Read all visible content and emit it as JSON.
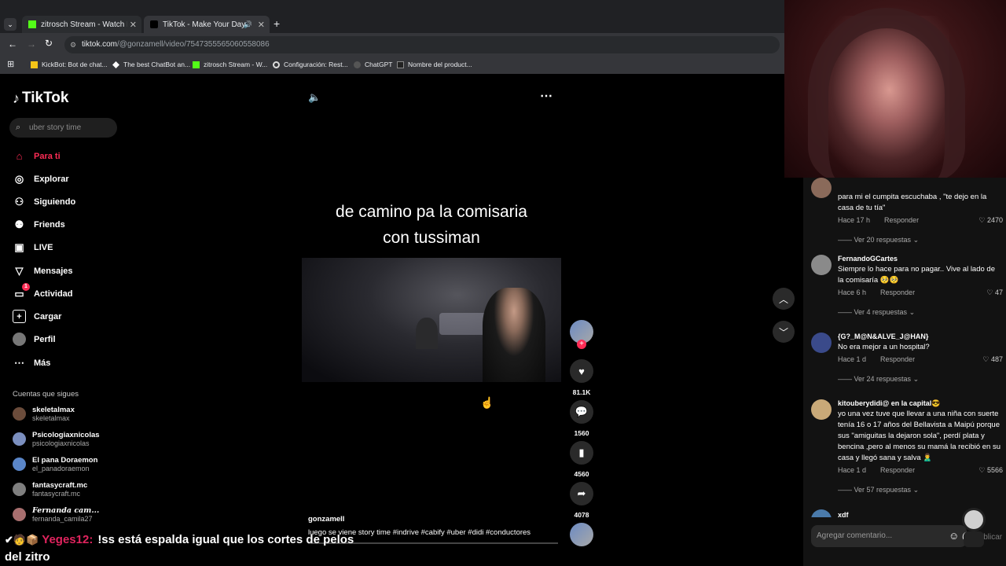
{
  "browser": {
    "tabs": [
      {
        "label": "zitrosch Stream - Watch Live on",
        "close": "✕"
      },
      {
        "label": "TikTok - Make Your Day",
        "close": "✕"
      }
    ],
    "new_tab": "+",
    "url_host": "tiktok.com",
    "url_path": "/@gonzamell/video/7547355565060558086",
    "bookmarks": [
      "KickBot: Bot de chat...",
      "The best ChatBot an...",
      "zitrosch Stream - W...",
      "Configuración: Rest...",
      "ChatGPT",
      "Nombre del product..."
    ]
  },
  "tiktok": {
    "logo": "TikTok",
    "search_placeholder": "uber story time",
    "nav": [
      "Para ti",
      "Explorar",
      "Siguiendo",
      "Friends",
      "LIVE",
      "Mensajes",
      "Actividad",
      "Cargar",
      "Perfil",
      "Más"
    ],
    "activity_badge": "1",
    "following_heading": "Cuentas que sigues",
    "following": [
      {
        "name": "skeletalmax",
        "handle": "skeletalmax",
        "color": "#6b4c3b"
      },
      {
        "name": "Psicologiaxnicolas",
        "handle": "psicologiaxnicolas",
        "color": "#7b8fbf"
      },
      {
        "name": "El pana Doraemon",
        "handle": "el_panadoraemon",
        "color": "#5a86c9"
      },
      {
        "name": "fantasycraft.mc",
        "handle": "fantasycraft.mc",
        "color": "#7f7f7f"
      },
      {
        "name": "Fernanda cam...",
        "handle": "fernanda_camila27",
        "color": "#a86f6f"
      }
    ],
    "caption_line1": "de camino pa la comisaria",
    "caption_line2": "con tussiman",
    "author": "gonzamell",
    "description": "luego se viene story time #indrive #cabify #uber #didi #conductores",
    "likes": "81.1K",
    "comments_count": "1560",
    "saves": "4560",
    "shares": "4078"
  },
  "comments": [
    {
      "user": "",
      "text": "para mi el cumpita escuchaba , \"te dejo en la casa de tu tía\"",
      "time": "Hace 17 h",
      "reply": "Responder",
      "likes": "2470",
      "more": "Ver 20 respuestas",
      "color": "#8a6a5a"
    },
    {
      "user": "FernandoGCartes",
      "text": "Siempre lo hace para no pagar.. Vive al lado de la comisaría 🥺🥺",
      "time": "Hace 6 h",
      "reply": "Responder",
      "likes": "47",
      "more": "Ver 4 respuestas",
      "color": "#8a8a8a"
    },
    {
      "user": "{G?_M@N&ALVE_J@HAN}",
      "text": "No era mejor a un hospital?",
      "time": "Hace 1 d",
      "reply": "Responder",
      "likes": "487",
      "more": "Ver 24 respuestas",
      "color": "#3a4a8a"
    },
    {
      "user": "kitouberydidi@ en la capital😎",
      "text": "yo una vez tuve que llevar a una niña con suerte tenía 16 o 17 años del Bellavista a Maipú porque sus \"amiguitas la dejaron sola\", perdí plata y bencina ,pero al menos su mamá la recibió en su casa y llegó sana y salva 🙎‍♂️",
      "time": "Hace 1 d",
      "reply": "Responder",
      "likes": "5566",
      "more": "Ver 57 respuestas",
      "color": "#c9a978"
    },
    {
      "user": "xdf",
      "text": "",
      "time": "",
      "reply": "",
      "likes": "",
      "more": "",
      "color": "#4a7aaa"
    }
  ],
  "comment_input_placeholder": "Agregar comentario...",
  "publish": "Publicar",
  "chat": {
    "user": "Yeges12:",
    "message": "!ss está espalda igual que los cortes de pelos",
    "message2": "del zitro"
  }
}
